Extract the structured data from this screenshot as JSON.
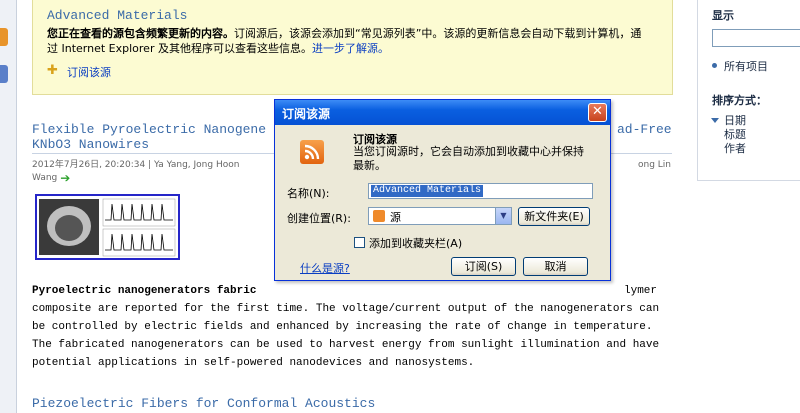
{
  "infobar": {
    "feed_title": "Advanced Materials",
    "desc_bold": "您正在查看的源包含频繁更新的内容。",
    "desc_text": "订阅源后，该源会添加到“常见源列表”中。该源的更新信息会自动下载到计算机，通过 Internet Explorer 及其他程序可以查看这些信息。",
    "learn_more": "进一步了解源。",
    "subscribe_link": "订阅该源"
  },
  "article1": {
    "title_line1": "Flexible Pyroelectric Nanogene",
    "title_line1_right": "ad-Free",
    "title_line2": "KNbO3 Nanowires",
    "meta": "2012年7月26日, 20:20:34 | Ya Yang, Jong Hoon",
    "meta_right": "ong Lin",
    "meta2": "Wang",
    "body_lead": "Pyroelectric nanogenerators fabric",
    "body_lead_right": "lymer",
    "body_rest": "composite are reported for the first time. The voltage/current output of the nanogenerators can be controlled by electric fields and enhanced by increasing the rate of change in temperature. The fabricated nanogenerators can be used to harvest energy from sunlight illumination and have potential applications in self-powered nanodevices and nanosystems."
  },
  "article2": {
    "title": "Piezoelectric Fibers for Conformal Acoustics"
  },
  "sidebar": {
    "display_head": "显示",
    "all_items": "所有项目",
    "sort_head": "排序方式：",
    "sort_options": [
      "日期",
      "标题",
      "作者"
    ]
  },
  "dialog": {
    "title": "订阅该源",
    "heading": "订阅该源",
    "description": "当您订阅源时，它会自动添加到收藏中心并保持最新。",
    "name_label": "名称(N):",
    "name_value": "Advanced Materials",
    "location_label": "创建位置(R):",
    "location_value": "源",
    "new_folder_button": "新文件夹(E)",
    "add_favbar_label": "添加到收藏夹栏(A)",
    "what_is_feed": "什么是源?",
    "subscribe_button": "订阅(S)",
    "cancel_button": "取消"
  },
  "colors": {
    "link": "#3b6ba8",
    "infobar_bg": "#fcfbd2",
    "titlebar": "#0a5fe0"
  }
}
